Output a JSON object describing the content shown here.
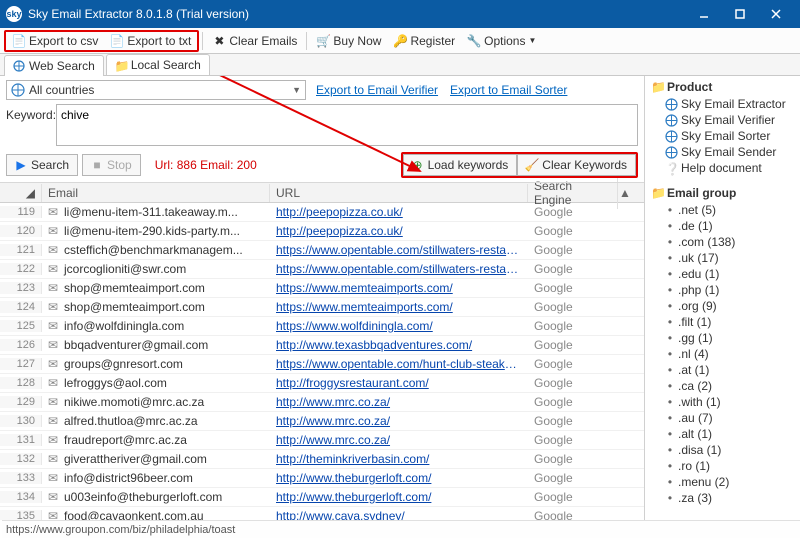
{
  "window": {
    "title": "Sky Email Extractor 8.0.1.8 (Trial version)"
  },
  "toolbar": {
    "export_csv": "Export to csv",
    "export_txt": "Export to txt",
    "clear_emails": "Clear Emails",
    "buy_now": "Buy Now",
    "register": "Register",
    "options": "Options"
  },
  "tabs": {
    "web": "Web Search",
    "local": "Local Search"
  },
  "search": {
    "country": "All countries",
    "export_verifier": "Export to Email Verifier",
    "export_sorter": "Export to Email Sorter",
    "keyword_label": "Keyword:",
    "keyword_value": "chive",
    "search_btn": "Search",
    "stop_btn": "Stop",
    "stats": "Url: 886 Email: 200",
    "load_kw": "Load keywords",
    "clear_kw": "Clear Keywords"
  },
  "grid": {
    "headers": {
      "email": "Email",
      "url": "URL",
      "se": "Search Engine"
    },
    "rows": [
      {
        "n": "119",
        "email": "li@menu-item-311.takeaway.m...",
        "url": "http://peepopizza.co.uk/",
        "se": "Google"
      },
      {
        "n": "120",
        "email": "li@menu-item-290.kids-party.m...",
        "url": "http://peepopizza.co.uk/",
        "se": "Google"
      },
      {
        "n": "121",
        "email": "csteffich@benchmarkmanagem...",
        "url": "https://www.opentable.com/stillwaters-restaurant...",
        "se": "Google"
      },
      {
        "n": "122",
        "email": "jcorcoglioniti@swr.com",
        "url": "https://www.opentable.com/stillwaters-restaurant...",
        "se": "Google"
      },
      {
        "n": "123",
        "email": "shop@memteaimport.com",
        "url": "https://www.memteaimports.com/",
        "se": "Google"
      },
      {
        "n": "124",
        "email": "shop@memteaimport.com",
        "url": "https://www.memteaimports.com/",
        "se": "Google"
      },
      {
        "n": "125",
        "email": "info@wolfdiningla.com",
        "url": "https://www.wolfdiningla.com/",
        "se": "Google"
      },
      {
        "n": "126",
        "email": "bbqadventurer@gmail.com",
        "url": "http://www.texasbbqadventures.com/",
        "se": "Google"
      },
      {
        "n": "127",
        "email": "groups@gnresort.com",
        "url": "https://www.opentable.com/hunt-club-steakhouse",
        "se": "Google"
      },
      {
        "n": "128",
        "email": "lefroggys@aol.com",
        "url": "http://froggysrestaurant.com/",
        "se": "Google"
      },
      {
        "n": "129",
        "email": "nikiwe.momoti@mrc.ac.za",
        "url": "http://www.mrc.co.za/",
        "se": "Google"
      },
      {
        "n": "130",
        "email": "alfred.thutloa@mrc.ac.za",
        "url": "http://www.mrc.co.za/",
        "se": "Google"
      },
      {
        "n": "131",
        "email": "fraudreport@mrc.ac.za",
        "url": "http://www.mrc.co.za/",
        "se": "Google"
      },
      {
        "n": "132",
        "email": "giverattheriver@gmail.com",
        "url": "http://theminkriverbasin.com/",
        "se": "Google"
      },
      {
        "n": "133",
        "email": "info@district96beer.com",
        "url": "http://www.theburgerloft.com/",
        "se": "Google"
      },
      {
        "n": "134",
        "email": "u003einfo@theburgerloft.com",
        "url": "http://www.theburgerloft.com/",
        "se": "Google"
      },
      {
        "n": "135",
        "email": "food@cavaonkent.com.au",
        "url": "http://www.cava.sydney/",
        "se": "Google"
      }
    ]
  },
  "sidebar": {
    "product_hdr": "Product",
    "products": [
      "Sky Email Extractor",
      "Sky Email Verifier",
      "Sky Email Sorter",
      "Sky Email Sender",
      "Help document"
    ],
    "group_hdr": "Email group",
    "groups": [
      ".net (5)",
      ".de (1)",
      ".com (138)",
      ".uk (17)",
      ".edu (1)",
      ".php (1)",
      ".org (9)",
      ".filt (1)",
      ".gg (1)",
      ".nl (4)",
      ".at (1)",
      ".ca (2)",
      ".with (1)",
      ".au (7)",
      ".alt (1)",
      ".disa (1)",
      ".ro (1)",
      ".menu (2)",
      ".za (3)"
    ]
  },
  "status": "https://www.groupon.com/biz/philadelphia/toast"
}
